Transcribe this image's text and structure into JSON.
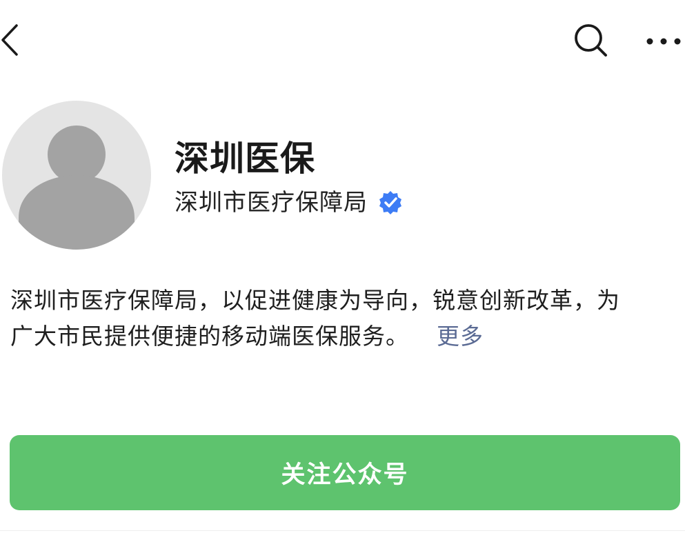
{
  "nav": {
    "back_icon": "chevron-left-icon",
    "search_icon": "search-icon",
    "more_icon": "more-horizontal-icon"
  },
  "profile": {
    "avatar_icon": "default-avatar-icon",
    "account_name": "深圳医保",
    "org_name": "深圳市医疗保障局",
    "verified_icon": "verified-badge-icon",
    "verified_color": "#3d7cf5"
  },
  "description": {
    "line1": "深圳市医疗保障局，以促进健康为导向，锐意创新改革，为",
    "line2": "广大市民提供便捷的移动端医保服务。",
    "more_label": "更多"
  },
  "actions": {
    "follow_label": "关注公众号",
    "follow_color": "#5ec36e"
  }
}
